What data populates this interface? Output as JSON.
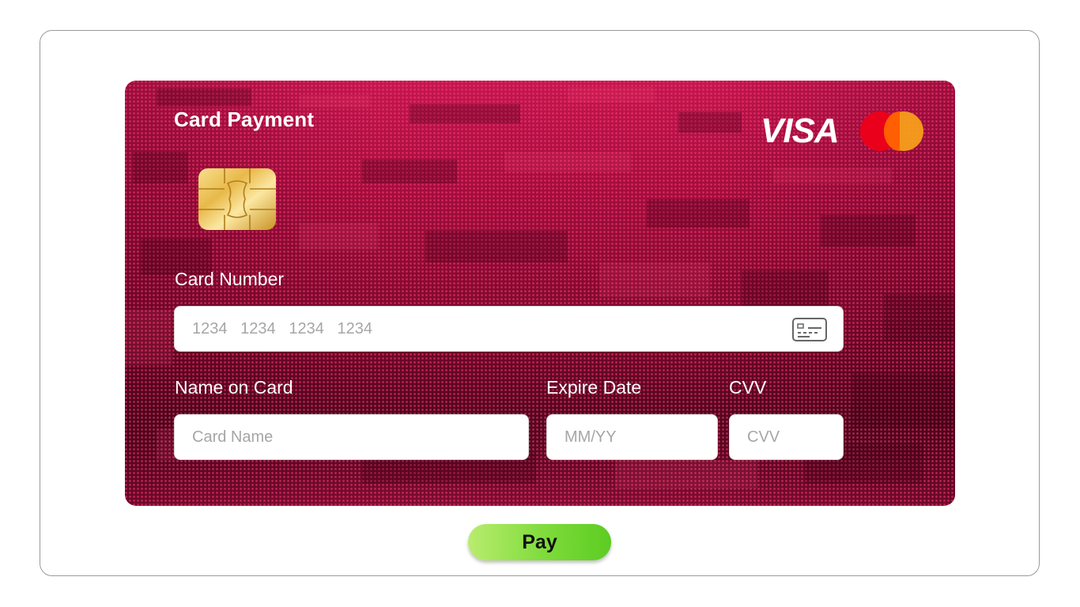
{
  "card": {
    "title": "Card Payment",
    "brands": {
      "visa_text": "VISA",
      "mastercard_icon": "mastercard-logo"
    },
    "chip_icon": "card-chip",
    "background_color": "#a50f3d"
  },
  "form": {
    "card_number": {
      "label": "Card Number",
      "placeholder": "1234   1234   1234   1234",
      "icon": "credit-card-icon"
    },
    "name_on_card": {
      "label": "Name on Card",
      "placeholder": "Card Name"
    },
    "expire_date": {
      "label": "Expire Date",
      "placeholder": "MM/YY"
    },
    "cvv": {
      "label": "CVV",
      "placeholder": "CVV"
    }
  },
  "pay_button": {
    "label": "Pay",
    "color": "#7ddb3a"
  }
}
